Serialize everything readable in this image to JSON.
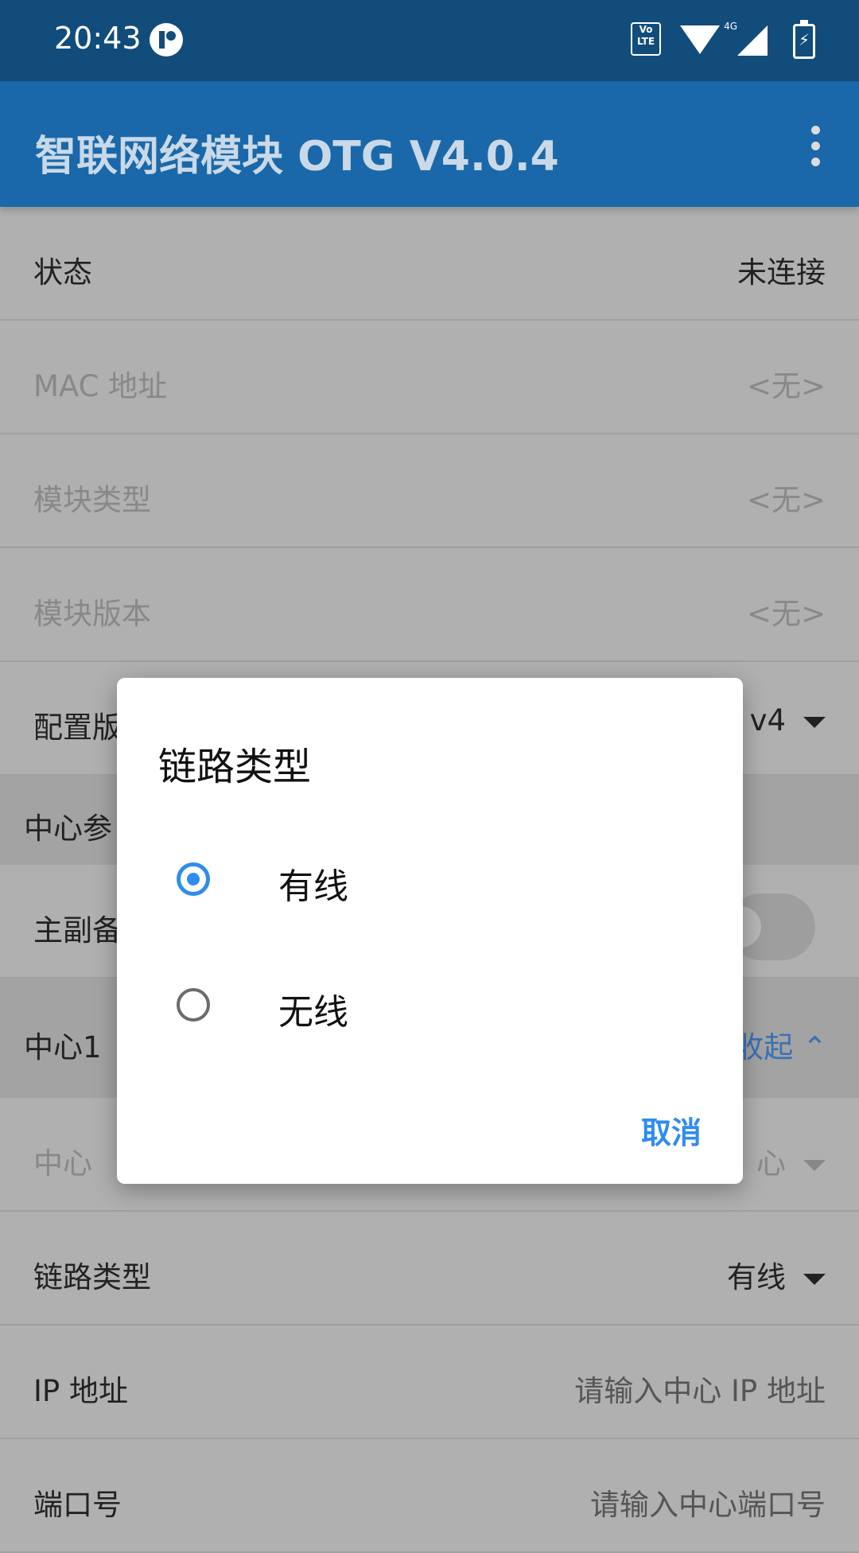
{
  "status_bar": {
    "time": "20:43",
    "volte": "Vo LTE",
    "network": "4G"
  },
  "app_bar": {
    "title": "智联网络模块 OTG V4.0.4"
  },
  "rows": {
    "status": {
      "label": "状态",
      "value": "未连接"
    },
    "mac": {
      "label": "MAC 地址",
      "value": "<无>"
    },
    "module_type": {
      "label": "模块类型",
      "value": "<无>"
    },
    "module_version": {
      "label": "模块版本",
      "value": "<无>"
    },
    "config_version": {
      "label": "配置版",
      "value": "v4"
    },
    "center_params": {
      "label": "中心参"
    },
    "main_backup": {
      "label": "主副备"
    },
    "center1": {
      "label": "中心1",
      "collapse": "收起"
    },
    "center": {
      "label": "中心",
      "value": "心"
    },
    "link_type": {
      "label": "链路类型",
      "value": "有线"
    },
    "ip": {
      "label": "IP 地址",
      "placeholder": "请输入中心 IP 地址"
    },
    "port": {
      "label": "端口号",
      "placeholder": "请输入中心端口号"
    }
  },
  "dialog": {
    "title": "链路类型",
    "options": [
      {
        "label": "有线",
        "selected": true
      },
      {
        "label": "无线",
        "selected": false
      }
    ],
    "cancel": "取消"
  },
  "colors": {
    "accent": "#2f8cf0",
    "app_bar": "#1a68a9",
    "status_bar": "#124c7b"
  }
}
